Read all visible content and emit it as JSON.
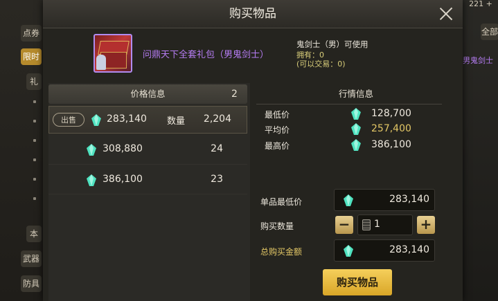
{
  "background": {
    "left_tabs": [
      "点券",
      "限时",
      "礼",
      "本",
      "武器",
      "防具"
    ],
    "right_top": "221 +",
    "right_button": "全部",
    "right_item": "男鬼剑士"
  },
  "dialog": {
    "title": "购买物品",
    "item": {
      "name": "问鼎天下全套礼包（男鬼剑士）",
      "requirement": "鬼剑士（男）可使用",
      "owned": "拥有：0",
      "tradable": "(可以交易：0)"
    },
    "price_list": {
      "title": "价格信息",
      "count": "2",
      "sell_badge": "出售",
      "qty_label": "数量",
      "rows": [
        {
          "price": "283,140",
          "qty": "2,204"
        },
        {
          "price": "308,880",
          "qty": "24"
        },
        {
          "price": "386,100",
          "qty": "23"
        }
      ]
    },
    "market": {
      "title": "行情信息",
      "rows": [
        {
          "label": "最低价",
          "value": "128,700"
        },
        {
          "label": "平均价",
          "value": "257,400"
        },
        {
          "label": "最高价",
          "value": "386,100"
        }
      ]
    },
    "purchase": {
      "unit_price_label": "单品最低价",
      "unit_price": "283,140",
      "quantity_label": "购买数量",
      "quantity": "1",
      "minus": "−",
      "plus": "+",
      "total_label": "总购买金额",
      "total": "283,140",
      "buy_button": "购买物品"
    }
  },
  "colors": {
    "accent_gold": "#e3c766",
    "item_purple": "#b57cf2",
    "gem": "#4fe3c0",
    "buy_button": "#e9b83a"
  }
}
